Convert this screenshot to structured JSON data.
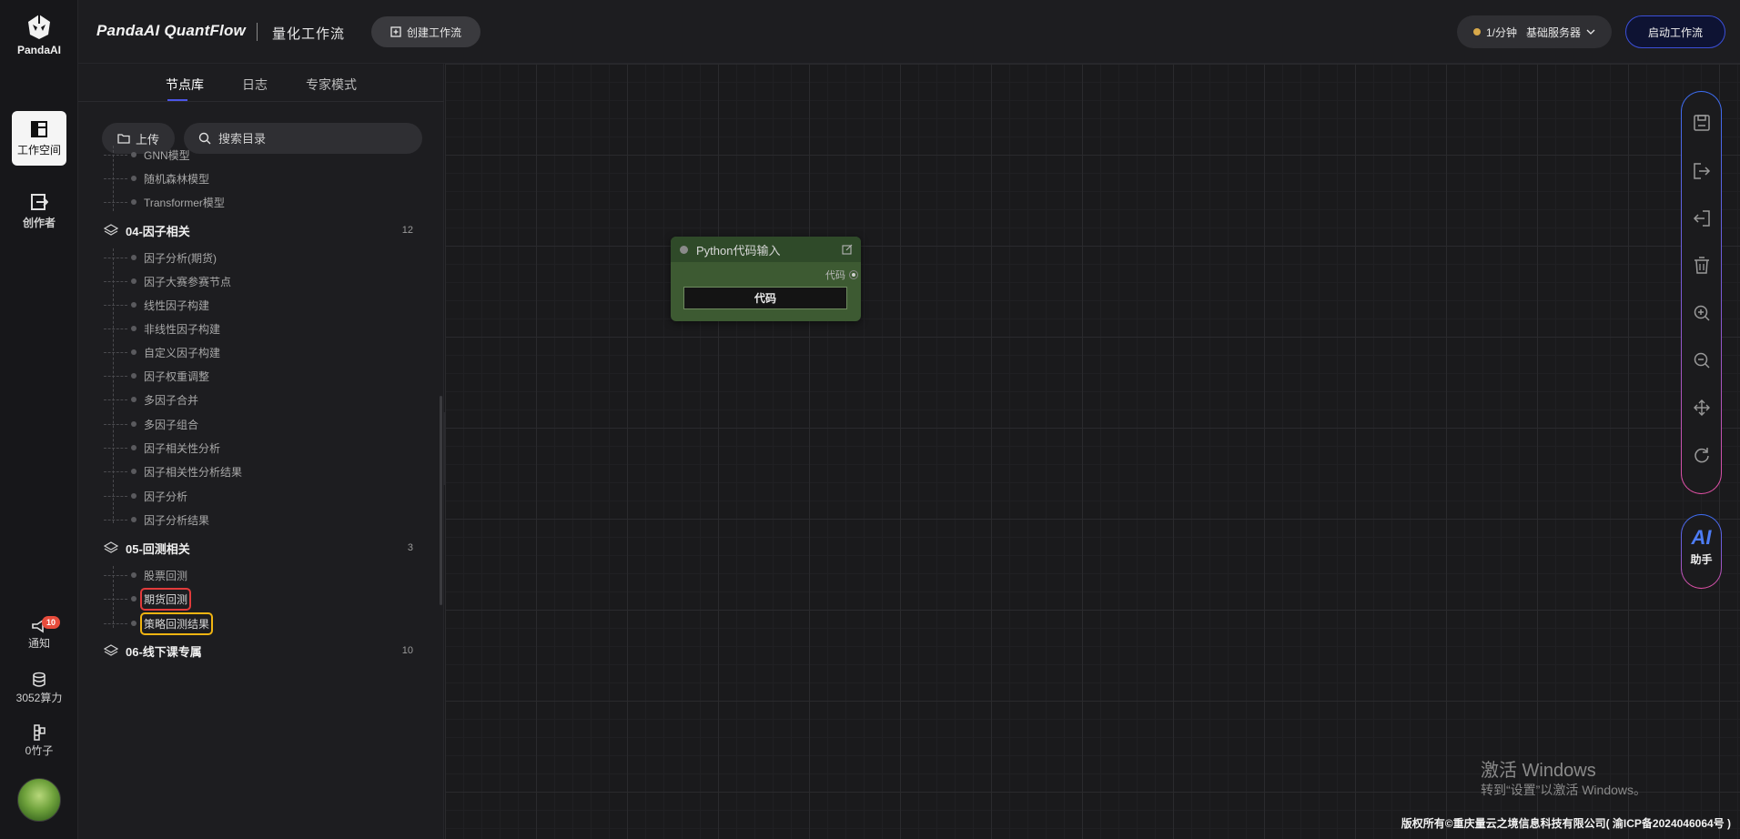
{
  "rail": {
    "logo_text": "PandaAI",
    "workspace_label": "工作空间",
    "creator_label": "创作者",
    "notify_label": "通知",
    "notify_count": "10",
    "compute_label": "3052算力",
    "bamboo_label": "0竹子"
  },
  "header": {
    "brand": "PandaAI QuantFlow",
    "subtitle": "量化工作流",
    "create_label": "创建工作流",
    "server_rate": "1/分钟",
    "server_name": "基础服务器",
    "start_label": "启动工作流"
  },
  "panel": {
    "tabs": [
      {
        "label": "节点库",
        "active": true
      },
      {
        "label": "日志",
        "active": false
      },
      {
        "label": "专家模式",
        "active": false
      }
    ],
    "upload_label": "上传",
    "search_placeholder": "搜索目录",
    "top_leaves": [
      "GNN模型",
      "随机森林模型",
      "Transformer模型"
    ],
    "groups": [
      {
        "title": "04-因子相关",
        "count": "12",
        "items": [
          "因子分析(期货)",
          "因子大赛参赛节点",
          "线性因子构建",
          "非线性因子构建",
          "自定义因子构建",
          "因子权重调整",
          "多因子合并",
          "多因子组合",
          "因子相关性分析",
          "因子相关性分析结果",
          "因子分析",
          "因子分析结果"
        ]
      },
      {
        "title": "05-回测相关",
        "count": "3",
        "items": [
          "股票回测",
          "期货回测",
          "策略回测结果"
        ]
      },
      {
        "title": "06-线下课专属",
        "count": "10",
        "items": []
      }
    ]
  },
  "node": {
    "title": "Python代码输入",
    "output_label": "代码",
    "button_label": "代码"
  },
  "toolbar": {
    "icons": [
      "save-icon",
      "export-icon",
      "import-icon",
      "delete-icon",
      "zoom-in-icon",
      "zoom-out-icon",
      "fit-view-icon",
      "refresh-icon"
    ],
    "ai_text": "AI",
    "ai_label": "助手"
  },
  "watermark": {
    "line1": "激活 Windows",
    "line2": "转到“设置”以激活 Windows。"
  },
  "footer": "版权所有©重庆量云之境信息科技有限公司( 渝ICP备2024046064号 )",
  "colors": {
    "accent": "#4b55e6",
    "node_bg": "#3d5a32",
    "highlight_red": "#e23b3b",
    "highlight_yellow": "#f0b412"
  }
}
